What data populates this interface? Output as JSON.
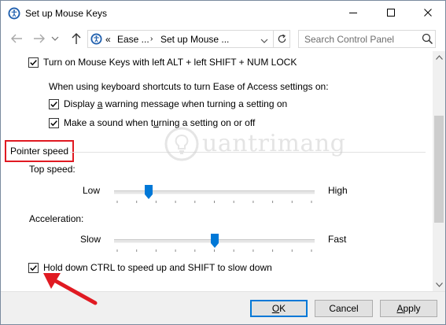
{
  "window": {
    "title": "Set up Mouse Keys"
  },
  "navbar": {
    "breadcrumb_prefix": "«",
    "breadcrumb": [
      "Ease ...",
      "Set up Mouse ..."
    ],
    "breadcrumb_separator": "›",
    "search_placeholder": "Search Control Panel"
  },
  "content": {
    "mouse_keys_shortcut": {
      "label": "Turn on Mouse Keys with left ALT + left SHIFT + NUM LOCK",
      "checked": true
    },
    "shortcut_settings_heading": "When using keyboard shortcuts to turn Ease of Access settings on:",
    "warning_option": {
      "pre": "Display ",
      "accel": "a",
      "post": " warning message when turning a setting on",
      "checked": true
    },
    "sound_option": {
      "pre": "Make a sound when t",
      "accel": "u",
      "post": "rning a setting on or off",
      "checked": true
    },
    "pointer_speed": {
      "heading": "Pointer speed",
      "top_speed": {
        "label": "Top speed:",
        "min_label": "Low",
        "max_label": "High",
        "value": 0.16
      },
      "acceleration": {
        "label": "Acceleration:",
        "min_label": "Slow",
        "max_label": "Fast",
        "value": 0.5
      }
    },
    "ctrl_shift_option": {
      "label": "Hold down CTRL to speed up and SHIFT to slow down",
      "checked": true
    }
  },
  "watermark": {
    "text": "uantrimang"
  },
  "buttons": {
    "ok_pre": "",
    "ok_accel": "O",
    "ok_post": "K",
    "cancel": "Cancel",
    "apply_pre": "",
    "apply_accel": "A",
    "apply_post": "pply"
  },
  "colors": {
    "highlight_border": "#e01a22",
    "arrow": "#e01a22",
    "slider_thumb": "#0078d7",
    "default_button_border": "#0078d7"
  }
}
